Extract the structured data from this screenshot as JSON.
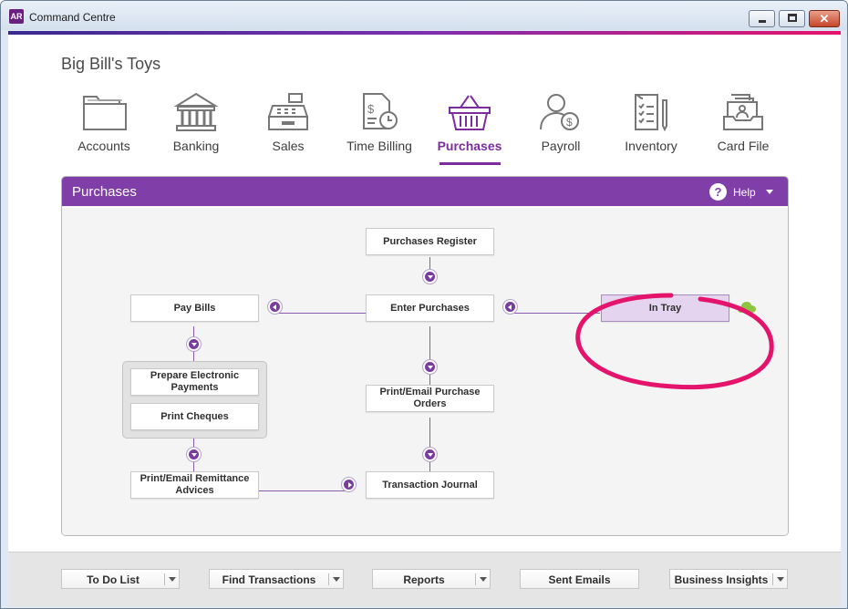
{
  "window": {
    "app_badge": "AR",
    "title": "Command Centre",
    "minimize_glyph": "minimize",
    "maximize_glyph": "maximize",
    "close_glyph": "✕"
  },
  "company_name": "Big Bill's Toys",
  "nav": [
    {
      "label": "Accounts",
      "icon": "folder-icon",
      "active": false
    },
    {
      "label": "Banking",
      "icon": "bank-icon",
      "active": false
    },
    {
      "label": "Sales",
      "icon": "cash-register-icon",
      "active": false
    },
    {
      "label": "Time Billing",
      "icon": "timesheet-clock-icon",
      "active": false
    },
    {
      "label": "Purchases",
      "icon": "shopping-basket-icon",
      "active": true
    },
    {
      "label": "Payroll",
      "icon": "person-dollar-icon",
      "active": false
    },
    {
      "label": "Inventory",
      "icon": "checklist-icon",
      "active": false
    },
    {
      "label": "Card File",
      "icon": "card-file-icon",
      "active": false
    }
  ],
  "panel": {
    "title": "Purchases",
    "help_label": "Help",
    "help_glyph": "?"
  },
  "flow": {
    "purchases_register": "Purchases Register",
    "enter_purchases": "Enter Purchases",
    "pay_bills": "Pay Bills",
    "in_tray": "In Tray",
    "prepare_electronic_payments": "Prepare Electronic Payments",
    "print_cheques": "Print Cheques",
    "print_email_purchase_orders": "Print/Email Purchase Orders",
    "print_email_remittance_advices": "Print/Email Remittance Advices",
    "transaction_journal": "Transaction Journal"
  },
  "bottom_bar": {
    "to_do_list": "To Do List",
    "find_transactions": "Find Transactions",
    "reports": "Reports",
    "sent_emails": "Sent Emails",
    "business_insights": "Business Insights"
  },
  "colors": {
    "accent": "#7f3ea8",
    "highlight_circle": "#e4146c",
    "in_tray_bg": "#e4d4ef",
    "cloud": "#8cc63f"
  }
}
